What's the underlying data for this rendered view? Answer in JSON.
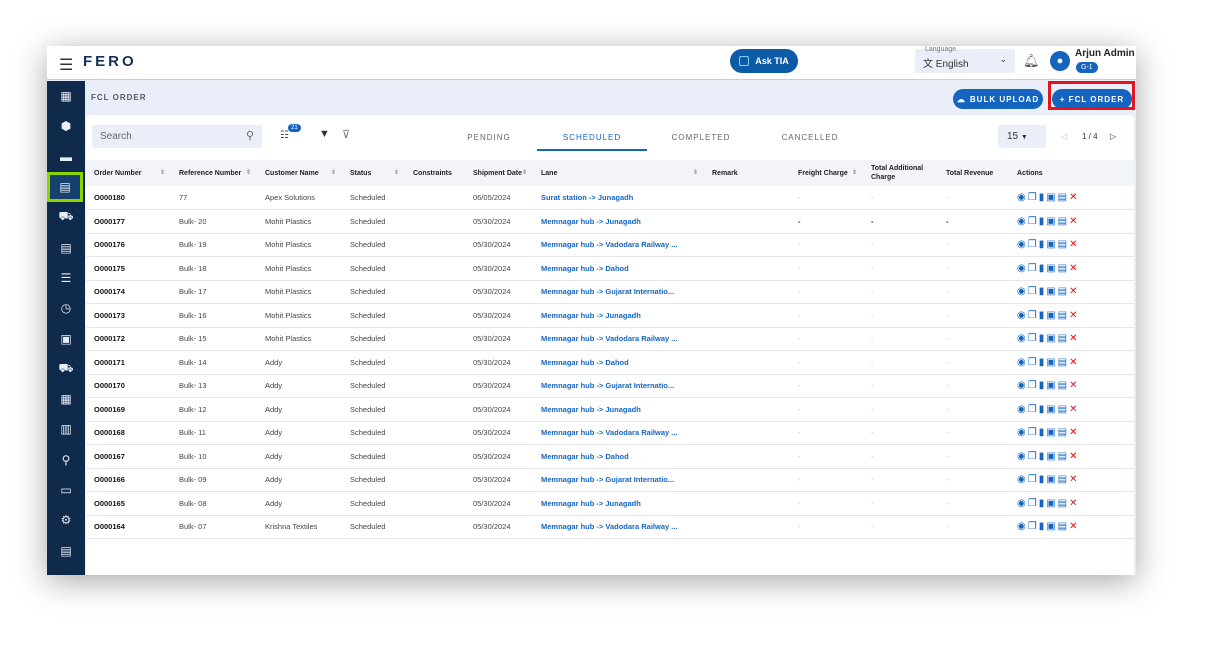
{
  "app": {
    "logo": "FERO",
    "ask": "Ask TIA",
    "language_label": "Language",
    "language": "English",
    "user": "Arjun Admin",
    "role": "G-1"
  },
  "page": {
    "title": "FCL ORDER",
    "bulk_upload": "BULK UPLOAD",
    "add": "+ FCL ORDER"
  },
  "toolbar": {
    "search_placeholder": "Search",
    "column_count": "21",
    "tabs": [
      "PENDING",
      "SCHEDULED",
      "COMPLETED",
      "CANCELLED"
    ],
    "active_tab": "SCHEDULED",
    "per_page": "15",
    "page": "1 / 4"
  },
  "columns": [
    "Order Number",
    "Reference Number",
    "Customer Name",
    "Status",
    "Constraints",
    "Shipment Date",
    "Lane",
    "Remark",
    "Freight Charge",
    "Total Additional Charge",
    "Total Revenue",
    "Actions"
  ],
  "rows": [
    [
      "O000180",
      "77",
      "Apex Solutions",
      "Scheduled",
      "",
      "06/05/2024",
      "Surat station -> Junagadh",
      "",
      "-",
      "-",
      "-"
    ],
    [
      "O000177",
      "Bulk- 20",
      "Mohit Plastics",
      "Scheduled",
      "",
      "05/30/2024",
      "Memnagar hub -> Junagadh",
      "",
      "-",
      "-",
      "-"
    ],
    [
      "O000176",
      "Bulk- 19",
      "Mohit Plastics",
      "Scheduled",
      "",
      "05/30/2024",
      "Memnagar hub -> Vadodara Railway ...",
      "",
      "-",
      "-",
      "-"
    ],
    [
      "O000175",
      "Bulk- 18",
      "Mohit Plastics",
      "Scheduled",
      "",
      "05/30/2024",
      "Memnagar hub -> Dahod",
      "",
      "-",
      "-",
      "-"
    ],
    [
      "O000174",
      "Bulk- 17",
      "Mohit Plastics",
      "Scheduled",
      "",
      "05/30/2024",
      "Memnagar hub -> Gujarat Internatio...",
      "",
      "-",
      "-",
      "-"
    ],
    [
      "O000173",
      "Bulk- 16",
      "Mohit Plastics",
      "Scheduled",
      "",
      "05/30/2024",
      "Memnagar hub -> Junagadh",
      "",
      "-",
      "-",
      "-"
    ],
    [
      "O000172",
      "Bulk- 15",
      "Mohit Plastics",
      "Scheduled",
      "",
      "05/30/2024",
      "Memnagar hub -> Vadodara Railway ...",
      "",
      "-",
      "-",
      "-"
    ],
    [
      "O000171",
      "Bulk- 14",
      "Addy",
      "Scheduled",
      "",
      "05/30/2024",
      "Memnagar hub -> Dahod",
      "",
      "-",
      "-",
      "-"
    ],
    [
      "O000170",
      "Bulk- 13",
      "Addy",
      "Scheduled",
      "",
      "05/30/2024",
      "Memnagar hub -> Gujarat Internatio...",
      "",
      "-",
      "-",
      "-"
    ],
    [
      "O000169",
      "Bulk- 12",
      "Addy",
      "Scheduled",
      "",
      "05/30/2024",
      "Memnagar hub -> Junagadh",
      "",
      "-",
      "-",
      "-"
    ],
    [
      "O000168",
      "Bulk- 11",
      "Addy",
      "Scheduled",
      "",
      "05/30/2024",
      "Memnagar hub -> Vadodara Railway ...",
      "",
      "-",
      "-",
      "-"
    ],
    [
      "O000167",
      "Bulk- 10",
      "Addy",
      "Scheduled",
      "",
      "05/30/2024",
      "Memnagar hub -> Dahod",
      "",
      "-",
      "-",
      "-"
    ],
    [
      "O000166",
      "Bulk- 09",
      "Addy",
      "Scheduled",
      "",
      "05/30/2024",
      "Memnagar hub -> Gujarat Internatio...",
      "",
      "-",
      "-",
      "-"
    ],
    [
      "O000165",
      "Bulk- 08",
      "Addy",
      "Scheduled",
      "",
      "05/30/2024",
      "Memnagar hub -> Junagadh",
      "",
      "-",
      "-",
      "-"
    ],
    [
      "O000164",
      "Bulk- 07",
      "Krishna Textiles",
      "Scheduled",
      "",
      "05/30/2024",
      "Memnagar hub -> Vadodara Railway ...",
      "",
      "-",
      "-",
      "-"
    ]
  ]
}
